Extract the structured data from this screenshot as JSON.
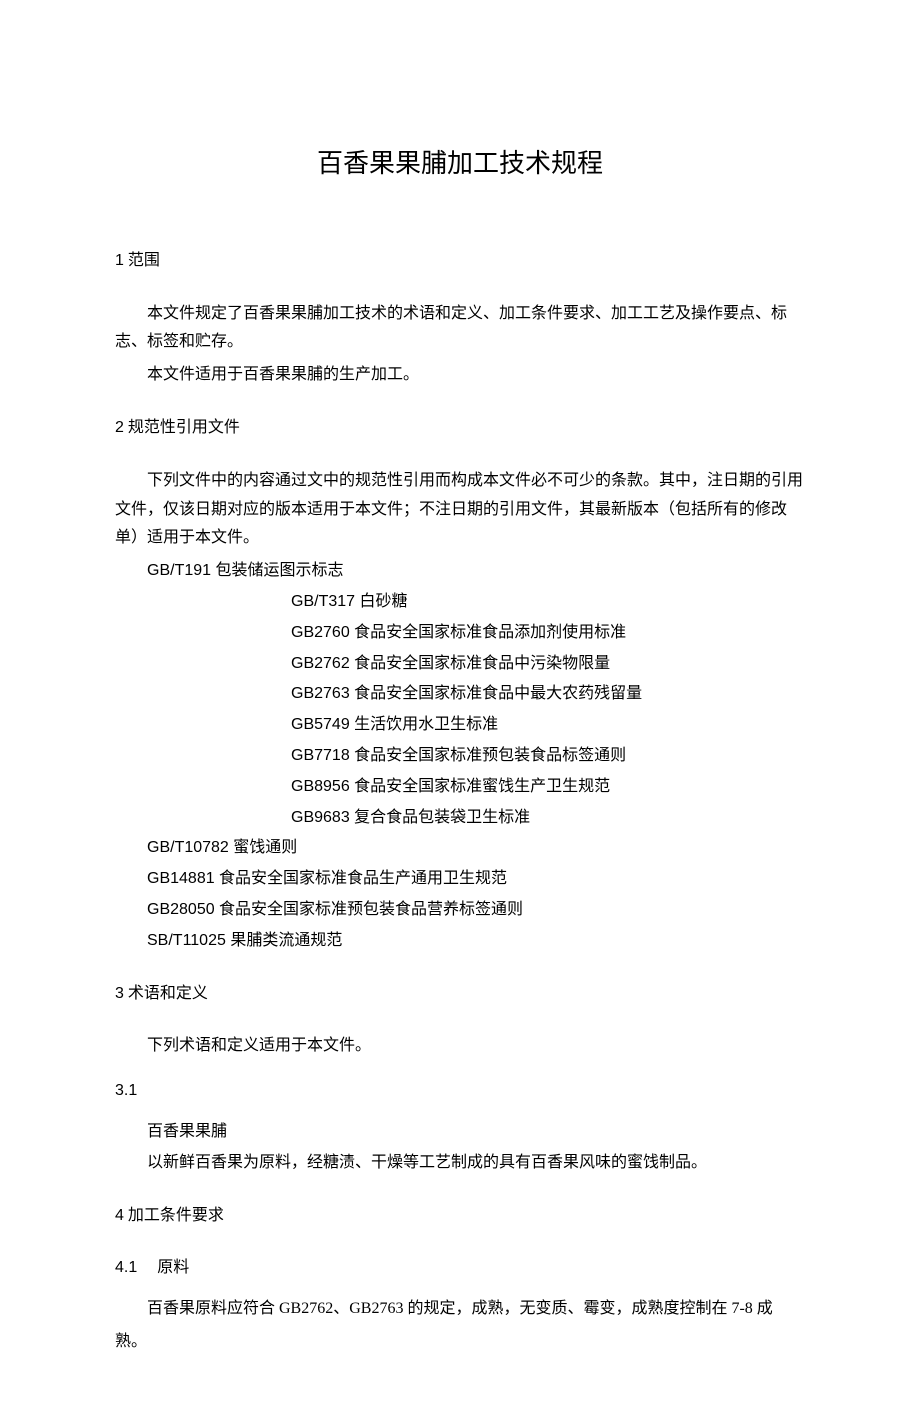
{
  "title": "百香果果脯加工技术规程",
  "sections": {
    "s1": {
      "num": "1",
      "heading": "范围",
      "p1": "本文件规定了百香果果脯加工技术的术语和定义、加工条件要求、加工工艺及操作要点、标志、标签和贮存。",
      "p2": "本文件适用于百香果果脯的生产加工。"
    },
    "s2": {
      "num": "2",
      "heading": "规范性引用文件",
      "p1": "下列文件中的内容通过文中的规范性引用而构成本文件必不可少的条款。其中，注日期的引用文件，仅该日期对应的版本适用于本文件；不注日期的引用文件，其最新版本（包括所有的修改单）适用于本文件。",
      "refs": [
        "GB/T191 包装储运图示标志",
        "GB/T317 白砂糖",
        "GB2760 食品安全国家标准食品添加剂使用标准",
        "GB2762 食品安全国家标准食品中污染物限量",
        "GB2763 食品安全国家标准食品中最大农药残留量",
        "GB5749 生活饮用水卫生标准",
        "GB7718 食品安全国家标准预包装食品标签通则",
        "GB8956 食品安全国家标准蜜饯生产卫生规范",
        "GB9683 复合食品包装袋卫生标准",
        "GB/T10782 蜜饯通则",
        "GB14881 食品安全国家标准食品生产通用卫生规范",
        "GB28050 食品安全国家标准预包装食品营养标签通则",
        "SB/T11025 果脯类流通规范"
      ]
    },
    "s3": {
      "num": "3",
      "heading": "术语和定义",
      "p1": "下列术语和定义适用于本文件。",
      "sub1": {
        "num": "3.1",
        "term": "百香果果脯",
        "def": "以新鲜百香果为原料，经糖渍、干燥等工艺制成的具有百香果风味的蜜饯制品。"
      }
    },
    "s4": {
      "num": "4",
      "heading": "加工条件要求",
      "sub1": {
        "num": "4.1",
        "heading": "原料",
        "p1_a": "百香果原料应符合 GB2762、GB2763 的规定，成熟，无变质、霉变，成熟度控制在 7-8 成",
        "p1_b": "熟。"
      }
    }
  }
}
